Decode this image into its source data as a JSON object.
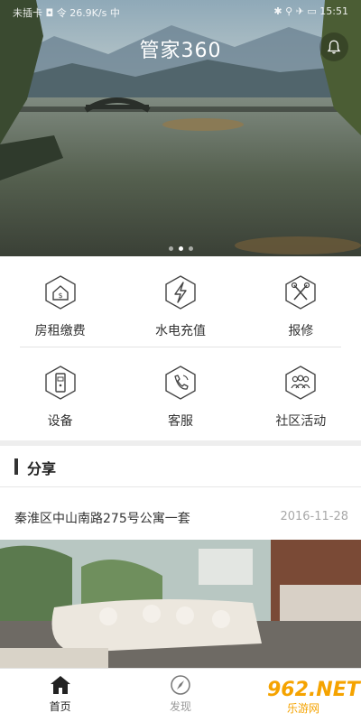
{
  "status_bar": {
    "left_text": "未插卡 ◘ 令 26.9K/s 中",
    "right_text": "✱ ⚲ ✈ ▭ 15:51"
  },
  "header": {
    "title": "管家360"
  },
  "banner": {
    "slide_count": 3,
    "active_slide": 2
  },
  "services": [
    {
      "label": "房租缴费",
      "icon": "rent-payment-icon"
    },
    {
      "label": "水电充值",
      "icon": "utility-recharge-icon"
    },
    {
      "label": "报修",
      "icon": "repair-tools-icon"
    },
    {
      "label": "设备",
      "icon": "device-door-icon"
    },
    {
      "label": "客服",
      "icon": "customer-service-phone-icon"
    },
    {
      "label": "社区活动",
      "icon": "community-people-icon"
    }
  ],
  "share": {
    "section_title": "分享",
    "items": [
      {
        "title": "秦淮区中山南路275号公寓一套",
        "date": "2016-11-28"
      }
    ]
  },
  "bottom_nav": [
    {
      "label": "首页",
      "icon": "home-icon",
      "active": true
    },
    {
      "label": "发现",
      "icon": "compass-icon",
      "active": false
    }
  ],
  "watermark": {
    "number": "962.NET",
    "text": "乐游网"
  },
  "colors": {
    "text": "#333333",
    "muted": "#a8a8a8",
    "divider": "#e3e3e3",
    "watermark": "#f5a300"
  }
}
